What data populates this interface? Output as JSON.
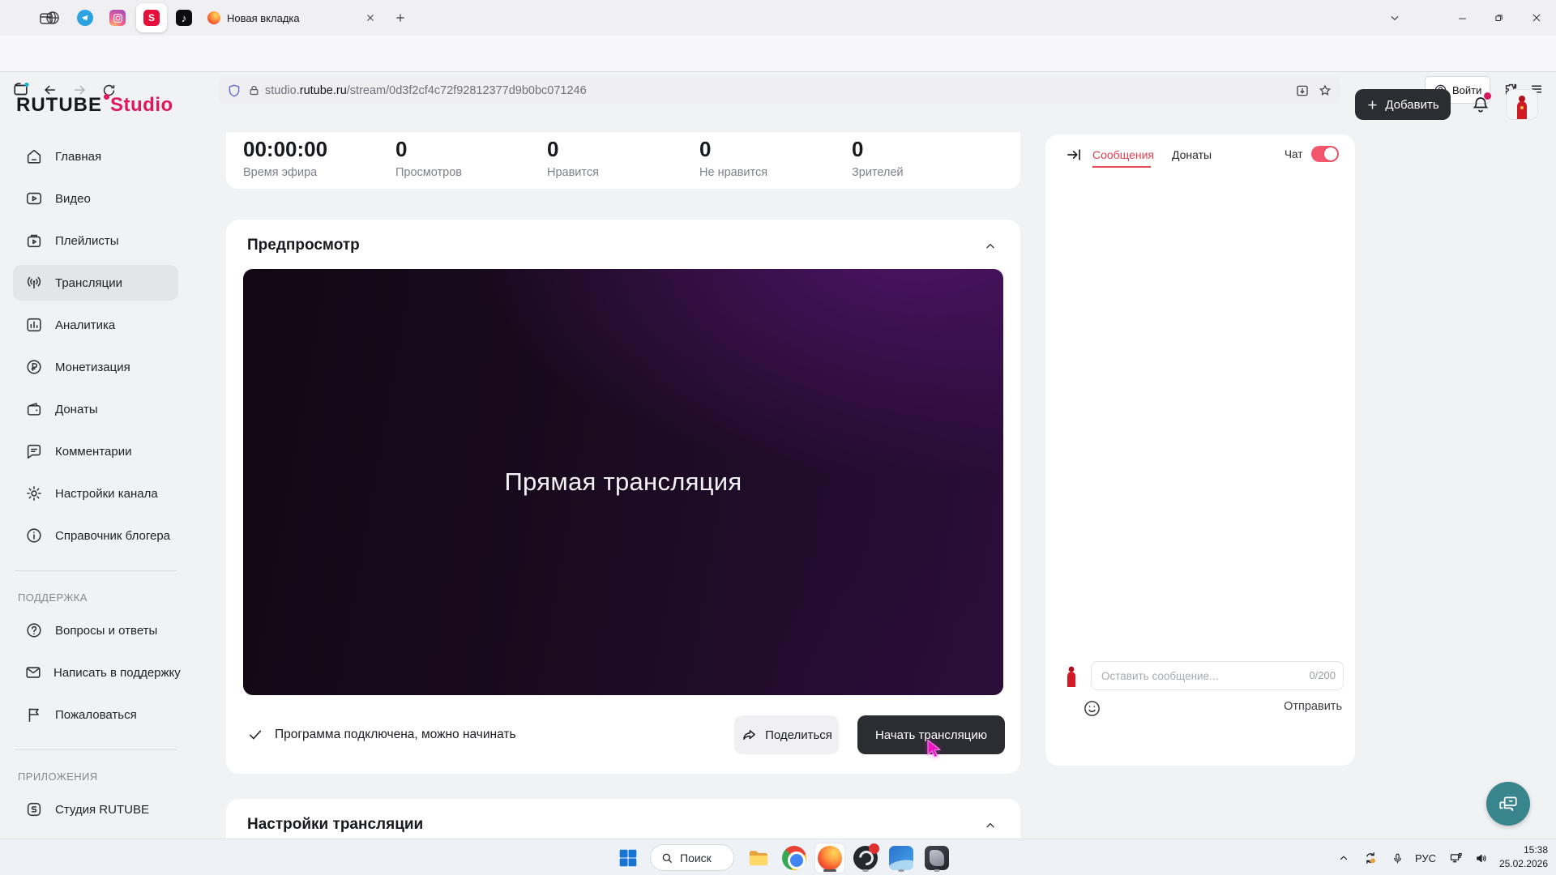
{
  "browser": {
    "tab": {
      "title": "Новая вкладка"
    },
    "url": {
      "subdomain": "studio.",
      "domain": "rutube.ru",
      "path": "/stream/0d3f2cf4c72f92812377d9b0bc071246"
    },
    "login_label": "Войти"
  },
  "header": {
    "logo_main": "RUTUBE",
    "logo_sub": "Studio",
    "add_label": "Добавить"
  },
  "sidebar": {
    "items": [
      {
        "label": "Главная",
        "icon": "home-icon",
        "active": false
      },
      {
        "label": "Видео",
        "icon": "video-icon",
        "active": false
      },
      {
        "label": "Плейлисты",
        "icon": "playlists-icon",
        "active": false
      },
      {
        "label": "Трансляции",
        "icon": "broadcast-icon",
        "active": true
      },
      {
        "label": "Аналитика",
        "icon": "analytics-icon",
        "active": false
      },
      {
        "label": "Монетизация",
        "icon": "monetization-icon",
        "active": false
      },
      {
        "label": "Донаты",
        "icon": "donates-icon",
        "active": false
      },
      {
        "label": "Комментарии",
        "icon": "comments-icon",
        "active": false
      },
      {
        "label": "Настройки канала",
        "icon": "gear-icon",
        "active": false
      },
      {
        "label": "Справочник блогера",
        "icon": "info-icon",
        "active": false
      }
    ],
    "support_title": "ПОДДЕРЖКА",
    "support_items": [
      {
        "label": "Вопросы и ответы",
        "icon": "question-icon"
      },
      {
        "label": "Написать в поддержку",
        "icon": "mail-icon"
      },
      {
        "label": "Пожаловаться",
        "icon": "flag-icon"
      }
    ],
    "apps_title": "ПРИЛОЖЕНИЯ",
    "apps_items": [
      {
        "label": "Студия RUTUBE",
        "icon": "studio-app-icon"
      }
    ]
  },
  "stats": [
    {
      "value": "00:00:00",
      "label": "Время эфира"
    },
    {
      "value": "0",
      "label": "Просмотров"
    },
    {
      "value": "0",
      "label": "Нравится"
    },
    {
      "value": "0",
      "label": "Не нравится"
    },
    {
      "value": "0",
      "label": "Зрителей"
    }
  ],
  "preview": {
    "title": "Предпросмотр",
    "screen_text": "Прямая трансляция",
    "status_text": "Программа подключена, можно начинать",
    "share_label": "Поделиться",
    "start_label": "Начать трансляцию"
  },
  "stream_settings": {
    "title": "Настройки трансляции"
  },
  "chat": {
    "messages_tab": "Сообщения",
    "donates_tab": "Донаты",
    "toggle_label": "Чат",
    "toggle_state": "on",
    "placeholder": "Оставить сообщение...",
    "counter": "0/200",
    "send_label": "Отправить"
  },
  "taskbar": {
    "search_placeholder": "Поиск",
    "language": "РУС",
    "time": "15:38",
    "date": "25.02.2026"
  },
  "colors": {
    "accent_red": "#e0175b",
    "chat_tab_red": "#e0414e",
    "toggle_red": "#f4566e",
    "dark_button": "#2c2c33",
    "fab_teal": "#38858d",
    "cursor_magenta": "#ec13c3",
    "page_bg": "#f1f2f4"
  }
}
